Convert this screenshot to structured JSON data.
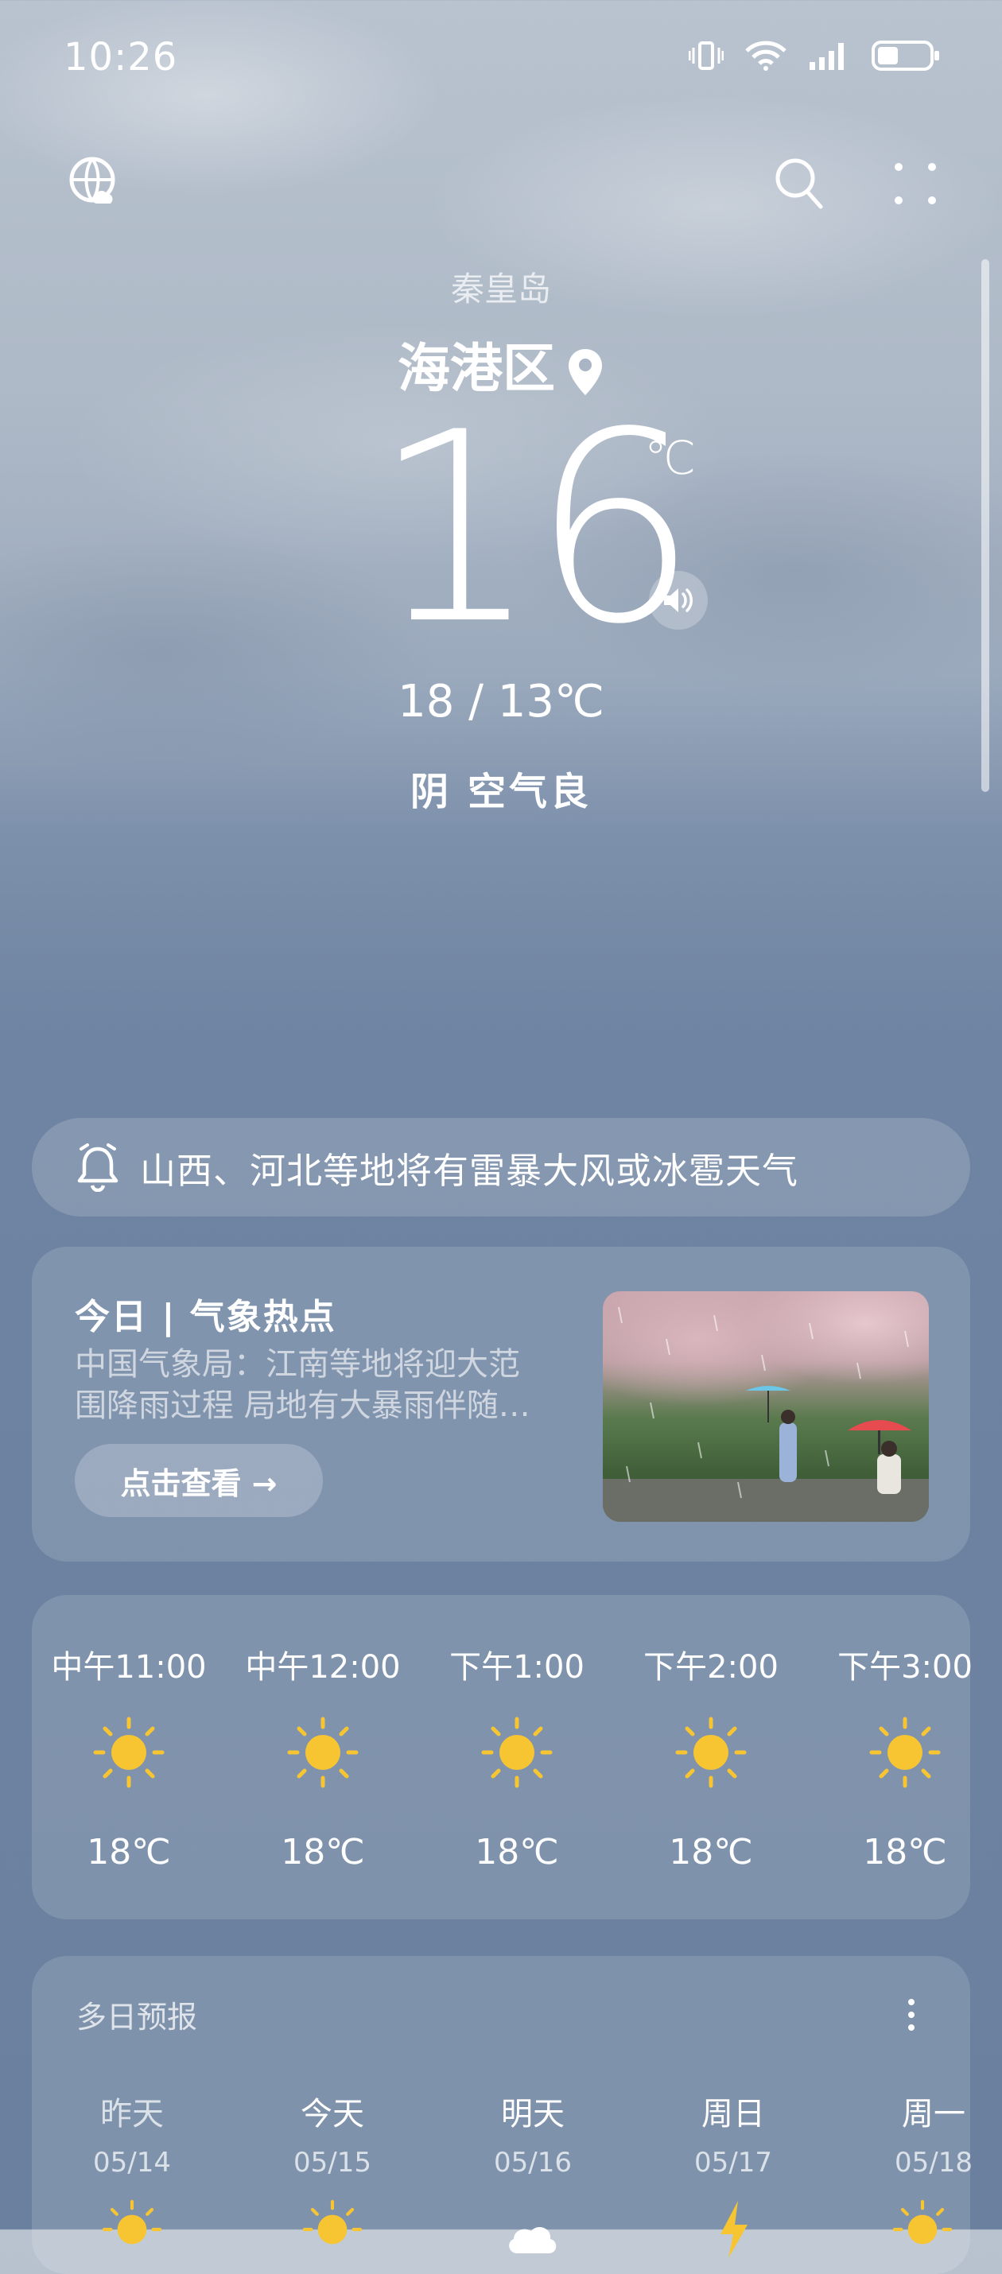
{
  "status_bar": {
    "time": "10:26",
    "battery_level": 0.4
  },
  "location": {
    "city": "秦皇岛",
    "district": "海港区"
  },
  "current": {
    "temp": "16",
    "unit": "℃",
    "high_low": "18 / 13℃",
    "condition": "阴",
    "air_quality": "空气良"
  },
  "alert": {
    "text": "山西、河北等地将有雷暴大风或冰雹天气"
  },
  "hot_topic": {
    "title": "今日 | 气象热点",
    "desc_line1": "中国气象局：江南等地将迎大范",
    "desc_line2": "围降雨过程 局地有大暴雨伴随…",
    "button": "点击查看 →"
  },
  "hourly": [
    {
      "time": "中午11:00",
      "icon": "sun-icon",
      "temp": "18℃"
    },
    {
      "time": "中午12:00",
      "icon": "sun-icon",
      "temp": "18℃"
    },
    {
      "time": "下午1:00",
      "icon": "sun-icon",
      "temp": "18℃"
    },
    {
      "time": "下午2:00",
      "icon": "sun-icon",
      "temp": "18℃"
    },
    {
      "time": "下午3:00",
      "icon": "sun-icon",
      "temp": "18℃"
    }
  ],
  "daily": {
    "title": "多日预报",
    "days": [
      {
        "name": "昨天",
        "date": "05/14",
        "icon": "sun-icon"
      },
      {
        "name": "今天",
        "date": "05/15",
        "icon": "sun-icon"
      },
      {
        "name": "明天",
        "date": "05/16",
        "icon": "cloud-icon"
      },
      {
        "name": "周日",
        "date": "05/17",
        "icon": "thunder-icon"
      },
      {
        "name": "周一",
        "date": "05/18",
        "icon": "sun-icon"
      }
    ]
  },
  "colors": {
    "sun": "#f7c531",
    "accent": "#ffffff"
  }
}
